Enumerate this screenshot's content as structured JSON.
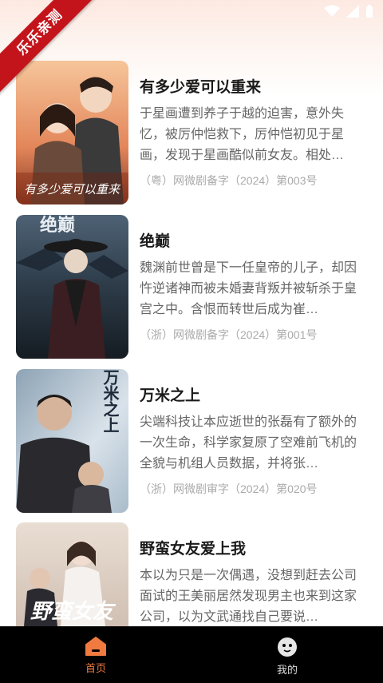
{
  "ribbon": {
    "text": "乐乐亲测"
  },
  "dramas": [
    {
      "title": "有多少爱可以重来",
      "desc": "于星画遭到养子于越的迫害，意外失忆，被厉仲恺救下，厉仲恺初见于星画，发现于星画酷似前女友。相处…",
      "record": "（粤）网微剧备字（2024）第003号",
      "poster_text": "有多少爱可以重来"
    },
    {
      "title": "绝巅",
      "desc": "魏渊前世曾是下一任皇帝的儿子，却因忤逆诸神而被未婚妻背叛并被斩杀于皇宫之中。含恨而转世后成为崔…",
      "record": "（浙）网微剧备字（2024）第001号",
      "poster_text": "绝巅"
    },
    {
      "title": "万米之上",
      "desc": "尖端科技让本应逝世的张磊有了额外的一次生命，科学家复原了空难前飞机的全貌与机组人员数据，并将张…",
      "record": "（浙）网微剧审字（2024）第020号",
      "poster_text": "万米之上"
    },
    {
      "title": "野蛮女友爱上我",
      "desc": "本以为只是一次偶遇，没想到赶去公司面试的王美丽居然发现男主也来到这家公司，以为文武通找自己要说…",
      "record": "",
      "poster_text": "野蛮女友"
    }
  ],
  "tabbar": {
    "home_label": "首页",
    "mine_label": "我的"
  },
  "colors": {
    "accent": "#f07a3f",
    "ribbon": "#c4141b",
    "tabbar_bg": "#000000"
  }
}
